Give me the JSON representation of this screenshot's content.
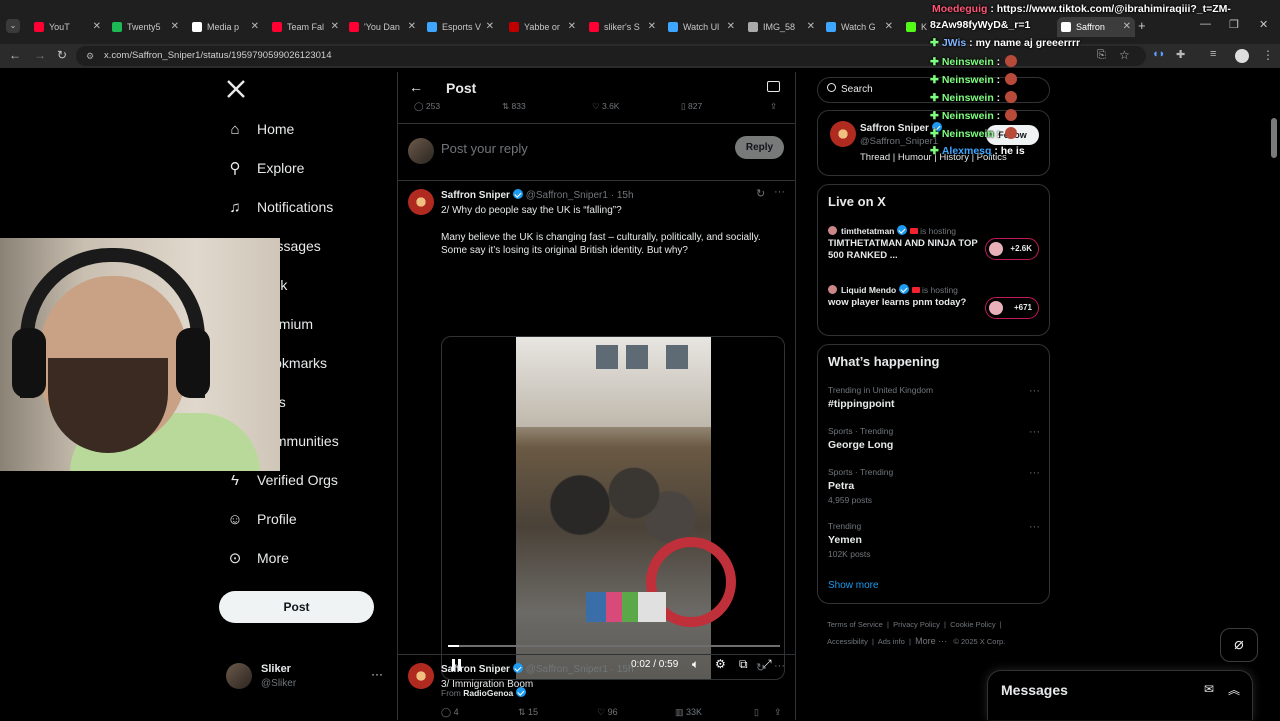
{
  "browser": {
    "tabs": [
      {
        "label": "YouT",
        "color": "#ff0033"
      },
      {
        "label": "Twenty5",
        "color": "#1db954"
      },
      {
        "label": "Media p",
        "color": "#ffffff"
      },
      {
        "label": "Team Fal",
        "color": "#ff0033"
      },
      {
        "label": "'You Dan",
        "color": "#ff0033"
      },
      {
        "label": "Esports V",
        "color": "#3ea6ff"
      },
      {
        "label": "Yabbe or",
        "color": "#c00000"
      },
      {
        "label": "sliker's S",
        "color": "#ff0033"
      },
      {
        "label": "Watch Ul",
        "color": "#3ea6ff"
      },
      {
        "label": "IMG_58",
        "color": "#aaaaaa"
      },
      {
        "label": "Watch G",
        "color": "#3ea6ff"
      },
      {
        "label": "K",
        "color": "#53fc18"
      },
      {
        "label": "Saffron",
        "color": "#ffffff"
      }
    ],
    "url": "x.com/Saffron_Sniper1/status/1959790599026123014"
  },
  "nav": {
    "items": [
      {
        "label": "Home",
        "icon": "home-icon"
      },
      {
        "label": "Explore",
        "icon": "search-icon"
      },
      {
        "label": "Notifications",
        "icon": "bell-icon"
      },
      {
        "label": "Messages",
        "icon": "mail-icon"
      },
      {
        "label": "Grok",
        "icon": "grok-icon"
      },
      {
        "label": "Premium",
        "icon": "x-icon"
      },
      {
        "label": "Bookmarks",
        "icon": "bookmark-icon"
      },
      {
        "label": "Lists",
        "icon": "list-icon"
      },
      {
        "label": "Communities",
        "icon": "people-icon"
      },
      {
        "label": "Verified Orgs",
        "icon": "lightning-icon"
      },
      {
        "label": "Profile",
        "icon": "person-icon"
      },
      {
        "label": "More",
        "icon": "more-icon"
      }
    ],
    "post_label": "Post",
    "account": {
      "name": "Sliker",
      "handle": "@Sliker"
    }
  },
  "main": {
    "header_title": "Post",
    "top_stats": {
      "replies": "253",
      "reposts": "833",
      "likes": "3.6K",
      "bookmarks": "827"
    },
    "reply_placeholder": "Post your reply",
    "reply_button": "Reply",
    "tweet2": {
      "name": "Saffron Sniper",
      "handle": "@Saffron_Sniper1",
      "time": "· 15h",
      "line1": "2/ Why do people say the UK is “falling”?",
      "line2": "Many believe the UK is changing fast – culturally, politically, and socially. Some say it’s losing its original British identity. But why?",
      "video_time": "0:02 / 0:59",
      "video_progress": 0.034,
      "from_label": "From",
      "from_account": "RadioGenoa",
      "stats": {
        "replies": "4",
        "reposts": "15",
        "likes": "96",
        "views": "33K"
      }
    },
    "tweet3": {
      "name": "Saffron Sniper",
      "handle": "@Saffron_Sniper1",
      "time": "· 15h",
      "text": "3/ Immigration Boom"
    }
  },
  "right": {
    "search_placeholder": "Search",
    "profile": {
      "name": "Saffron Sniper",
      "handle": "@Saffron_Sniper1",
      "bio": "Thread | Humour | History | Politics",
      "follow_label": "Follow"
    },
    "live": {
      "title": "Live on X",
      "items": [
        {
          "host": "timthetatman",
          "status": "is hosting",
          "title": "TIMTHETATMAN AND NINJA TOP 500 RANKED ...",
          "count": "+2.6K"
        },
        {
          "host": "Liquid Mendo",
          "status": "is hosting",
          "title": "wow player learns pnm today?",
          "count": "+671"
        }
      ]
    },
    "happening": {
      "title": "What’s happening",
      "trends": [
        {
          "meta": "Trending in United Kingdom",
          "title": "#tippingpoint",
          "posts": ""
        },
        {
          "meta": "Sports · Trending",
          "title": "George Long",
          "posts": ""
        },
        {
          "meta": "Sports · Trending",
          "title": "Petra",
          "posts": "4,959 posts"
        },
        {
          "meta": "Trending",
          "title": "Yemen",
          "posts": "102K posts"
        }
      ],
      "show_more": "Show more"
    },
    "footer": {
      "terms": "Terms of Service",
      "privacy": "Privacy Policy",
      "cookie": "Cookie Policy",
      "accessibility": "Accessibility",
      "ads": "Ads info",
      "more": "More ···",
      "copyright": "© 2025 X Corp."
    },
    "messages_title": "Messages"
  },
  "chat_overlay": [
    {
      "user": "Moedeguig",
      "color": "#ff5577",
      "text": "https://www.tiktok.com/@ibrahimiraqiii?_t=ZM-"
    },
    {
      "user": "",
      "color": "#ffffff",
      "text": "8zAw98fyWyD&_r=1"
    },
    {
      "user": "JWis",
      "color": "#7fb3ff",
      "text": "my name aj greeerrrr"
    },
    {
      "user": "Neinswein",
      "color": "#7fff7f",
      "text": ""
    },
    {
      "user": "Neinswein",
      "color": "#7fff7f",
      "text": ""
    },
    {
      "user": "Neinswein",
      "color": "#7fff7f",
      "text": ""
    },
    {
      "user": "Neinswein",
      "color": "#7fff7f",
      "text": ""
    },
    {
      "user": "Neinswein",
      "color": "#7fff7f",
      "text": ""
    },
    {
      "user": "Alexmesq",
      "color": "#3ea6ff",
      "text": "he is"
    }
  ]
}
